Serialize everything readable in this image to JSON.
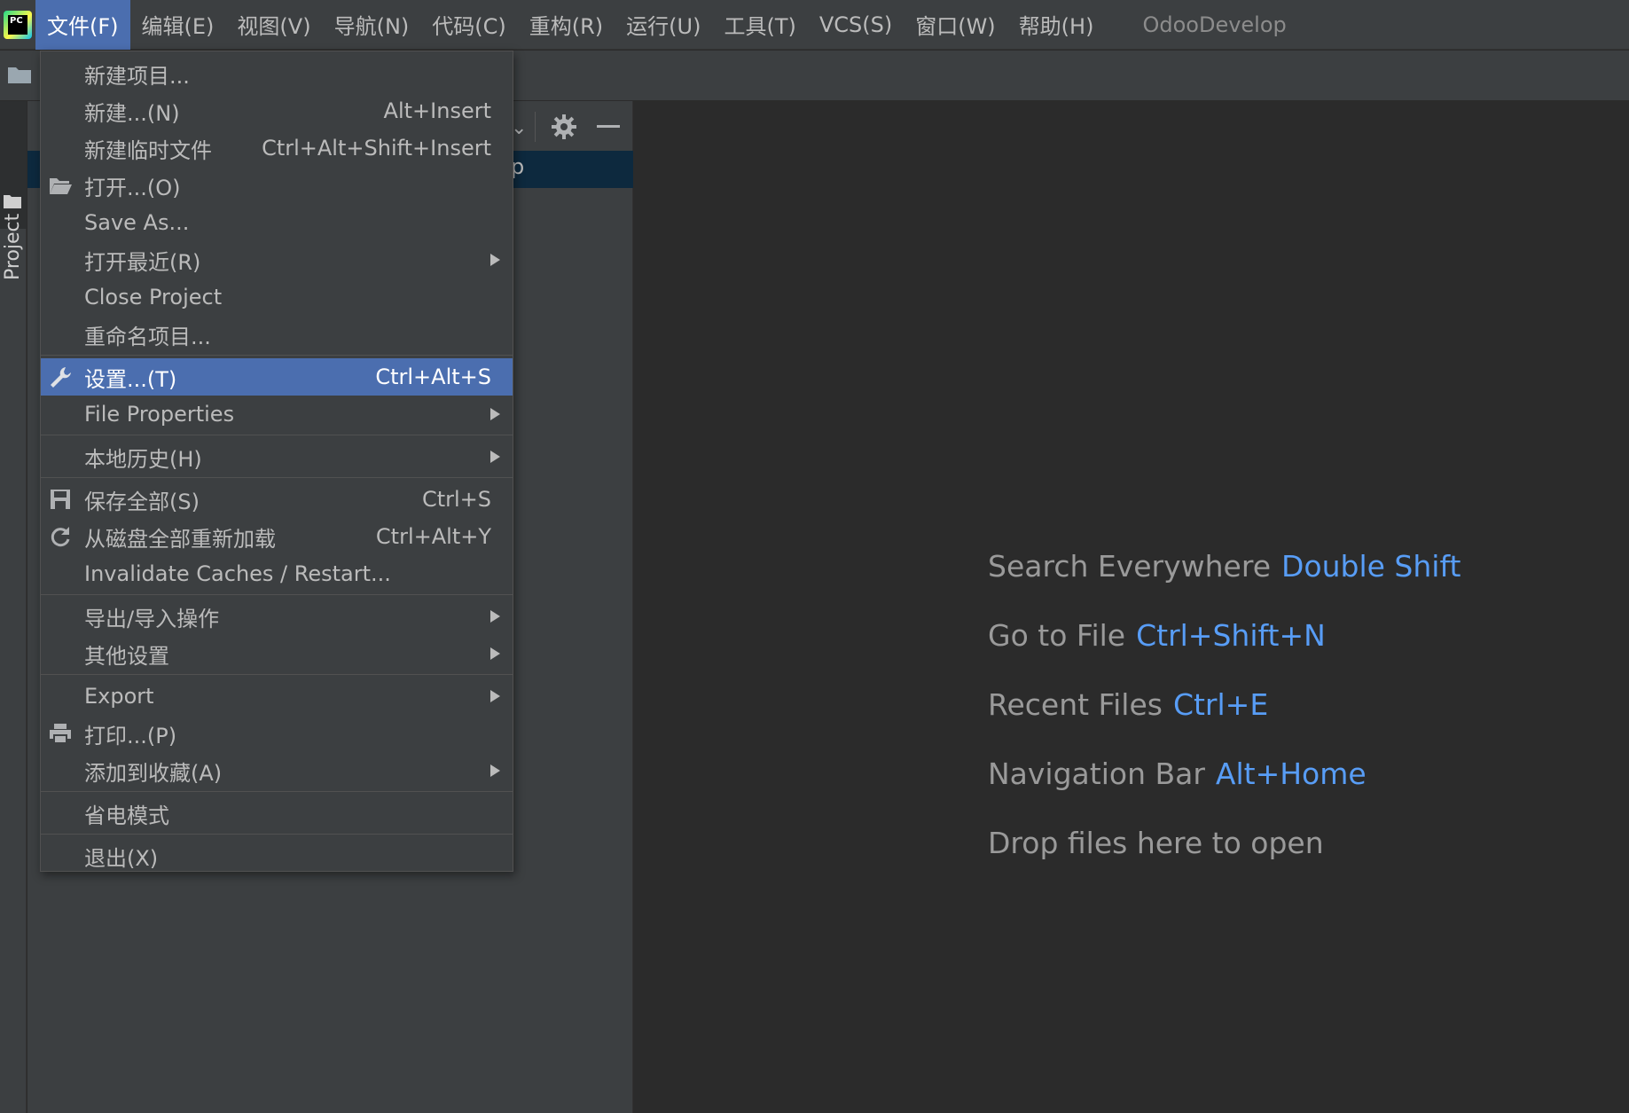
{
  "menubar": {
    "items": [
      {
        "label": "文件(F)",
        "active": true
      },
      {
        "label": "编辑(E)"
      },
      {
        "label": "视图(V)"
      },
      {
        "label": "导航(N)"
      },
      {
        "label": "代码(C)"
      },
      {
        "label": "重构(R)"
      },
      {
        "label": "运行(U)"
      },
      {
        "label": "工具(T)"
      },
      {
        "label": "VCS(S)"
      },
      {
        "label": "窗口(W)"
      },
      {
        "label": "帮助(H)"
      }
    ],
    "window_title": "OdooDevelop"
  },
  "logo": {
    "text": "PC"
  },
  "tool_stripe": {
    "project_tab_label": "Project"
  },
  "project_panel": {
    "selected_row_text": "p"
  },
  "file_menu": {
    "items": [
      {
        "label": "新建项目...",
        "shortcut": "",
        "submenu": false,
        "icon": ""
      },
      {
        "label": "新建...(N)",
        "shortcut": "Alt+Insert",
        "submenu": false,
        "icon": ""
      },
      {
        "label": "新建临时文件",
        "shortcut": "Ctrl+Alt+Shift+Insert",
        "submenu": false,
        "icon": ""
      },
      {
        "label": "打开...(O)",
        "shortcut": "",
        "submenu": false,
        "icon": "folder-open-icon"
      },
      {
        "label": "Save As...",
        "shortcut": "",
        "submenu": false,
        "icon": ""
      },
      {
        "label": "打开最近(R)",
        "shortcut": "",
        "submenu": true,
        "icon": ""
      },
      {
        "label": "Close Project",
        "shortcut": "",
        "submenu": false,
        "icon": ""
      },
      {
        "label": "重命名项目...",
        "shortcut": "",
        "submenu": false,
        "icon": ""
      },
      {
        "label": "设置...(T)",
        "shortcut": "Ctrl+Alt+S",
        "submenu": false,
        "icon": "wrench-icon",
        "highlighted": true
      },
      {
        "label": "File Properties",
        "shortcut": "",
        "submenu": true,
        "icon": ""
      },
      {
        "label": "本地历史(H)",
        "shortcut": "",
        "submenu": true,
        "icon": ""
      },
      {
        "label": "保存全部(S)",
        "shortcut": "Ctrl+S",
        "submenu": false,
        "icon": "save-icon"
      },
      {
        "label": "从磁盘全部重新加载",
        "shortcut": "Ctrl+Alt+Y",
        "submenu": false,
        "icon": "reload-icon"
      },
      {
        "label": "Invalidate Caches / Restart...",
        "shortcut": "",
        "submenu": false,
        "icon": ""
      },
      {
        "label": "导出/导入操作",
        "shortcut": "",
        "submenu": true,
        "icon": ""
      },
      {
        "label": "其他设置",
        "shortcut": "",
        "submenu": true,
        "icon": ""
      },
      {
        "label": "Export",
        "shortcut": "",
        "submenu": true,
        "icon": ""
      },
      {
        "label": "打印...(P)",
        "shortcut": "",
        "submenu": false,
        "icon": "print-icon"
      },
      {
        "label": "添加到收藏(A)",
        "shortcut": "",
        "submenu": true,
        "icon": ""
      },
      {
        "label": "省电模式",
        "shortcut": "",
        "submenu": false,
        "icon": ""
      },
      {
        "label": "退出(X)",
        "shortcut": "",
        "submenu": false,
        "icon": ""
      }
    ]
  },
  "editor_hints": [
    {
      "label": "Search Everywhere",
      "key": "Double Shift"
    },
    {
      "label": "Go to File",
      "key": "Ctrl+Shift+N"
    },
    {
      "label": "Recent Files",
      "key": "Ctrl+E"
    },
    {
      "label": "Navigation Bar",
      "key": "Alt+Home"
    },
    {
      "label": "Drop files here to open",
      "key": ""
    }
  ],
  "colors": {
    "menubar_bg": "#3c3f41",
    "editor_bg": "#2b2b2b",
    "highlight": "#4b6eaf",
    "hint_key": "#589df6",
    "selected_row": "#0d293e"
  }
}
